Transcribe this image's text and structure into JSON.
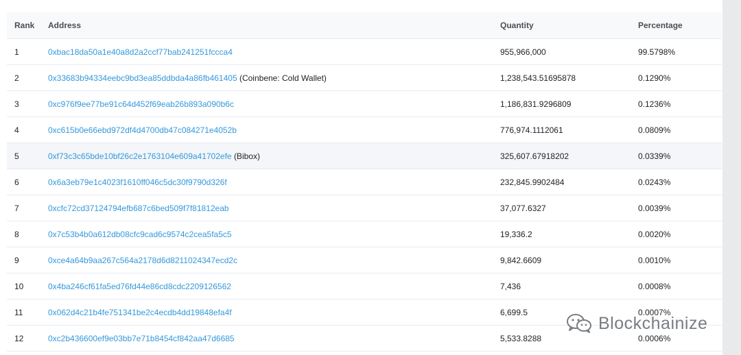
{
  "table": {
    "headers": {
      "rank": "Rank",
      "address": "Address",
      "quantity": "Quantity",
      "percentage": "Percentage"
    },
    "rows": [
      {
        "rank": "1",
        "address": "0xbac18da50a1e40a8d2a2ccf77bab241251fccca4",
        "tag": "",
        "quantity": "955,966,000",
        "percentage": "99.5798%"
      },
      {
        "rank": "2",
        "address": "0x33683b94334eebc9bd3ea85ddbda4a86fb461405",
        "tag": "(Coinbene: Cold Wallet)",
        "quantity": "1,238,543.51695878",
        "percentage": "0.1290%"
      },
      {
        "rank": "3",
        "address": "0xc976f9ee77be91c64d452f69eab26b893a090b6c",
        "tag": "",
        "quantity": "1,186,831.9296809",
        "percentage": "0.1236%"
      },
      {
        "rank": "4",
        "address": "0xc615b0e66ebd972df4d4700db47c084271e4052b",
        "tag": "",
        "quantity": "776,974.1112061",
        "percentage": "0.0809%"
      },
      {
        "rank": "5",
        "address": "0xf73c3c65bde10bf26c2e1763104e609a41702efe",
        "tag": "(Bibox)",
        "quantity": "325,607.67918202",
        "percentage": "0.0339%"
      },
      {
        "rank": "6",
        "address": "0x6a3eb79e1c4023f1610ff046c5dc30f9790d326f",
        "tag": "",
        "quantity": "232,845.9902484",
        "percentage": "0.0243%"
      },
      {
        "rank": "7",
        "address": "0xcfc72cd37124794efb687c6bed509f7f81812eab",
        "tag": "",
        "quantity": "37,077.6327",
        "percentage": "0.0039%"
      },
      {
        "rank": "8",
        "address": "0x7c53b4b0a612db08cfc9cad6c9574c2cea5fa5c5",
        "tag": "",
        "quantity": "19,336.2",
        "percentage": "0.0020%"
      },
      {
        "rank": "9",
        "address": "0xce4a64b9aa267c564a2178d6d8211024347ecd2c",
        "tag": "",
        "quantity": "9,842.6609",
        "percentage": "0.0010%"
      },
      {
        "rank": "10",
        "address": "0x4ba246cf61fa5ed76fd44e86cd8cdc2209126562",
        "tag": "",
        "quantity": "7,436",
        "percentage": "0.0008%"
      },
      {
        "rank": "11",
        "address": "0x062d4c21b4fe751341be2c4ecdb4dd19848efa4f",
        "tag": "",
        "quantity": "6,699.5",
        "percentage": "0.0007%"
      },
      {
        "rank": "12",
        "address": "0xc2b436600ef9e03bb7e71b8454cf842aa47d6685",
        "tag": "",
        "quantity": "5,533.8288",
        "percentage": "0.0006%"
      }
    ]
  },
  "watermark": {
    "text": "Blockchainize",
    "icon": "wechat-icon"
  },
  "colors": {
    "link": "#3498db",
    "header_bg": "#f8f9fa",
    "row_hover_bg": "#f4f6f9",
    "border": "#e7eaf3"
  }
}
